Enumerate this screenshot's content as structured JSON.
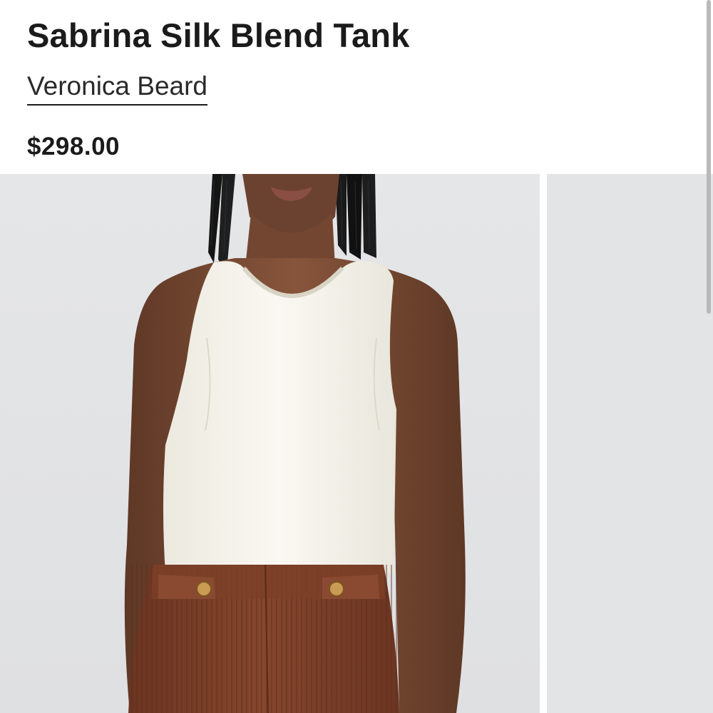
{
  "product": {
    "title": "Sabrina Silk Blend Tank",
    "brand": "Veronica Beard",
    "price": "$298.00"
  },
  "gallery": {
    "images": [
      {
        "name": "product-image-main"
      },
      {
        "name": "product-image-next"
      }
    ]
  },
  "colors": {
    "text": "#1b1b1b",
    "image_background": "#e6e7e9",
    "tank": "#f4f2ea",
    "skin": "#7a4a32",
    "pants": "#7b4029"
  }
}
